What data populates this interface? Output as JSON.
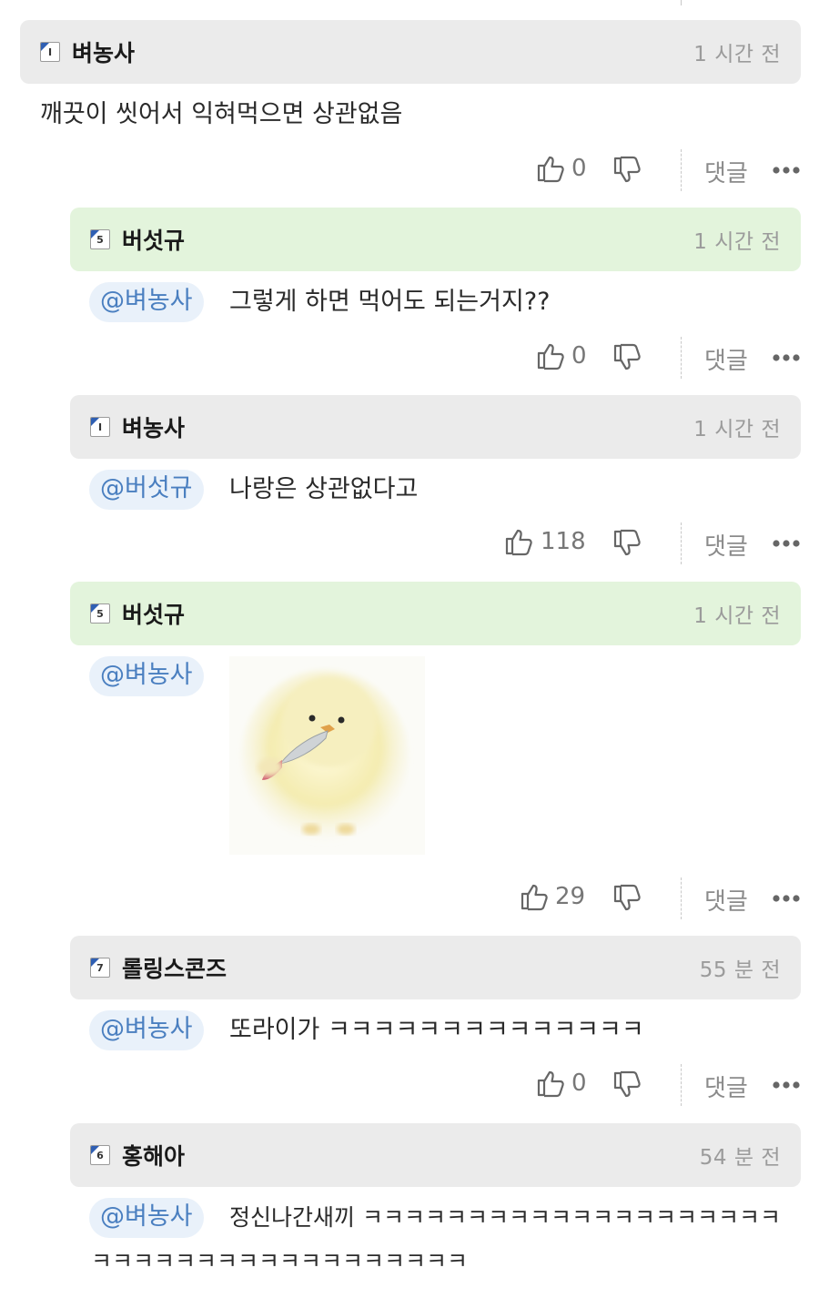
{
  "comments": [
    {
      "nick": "벼농사",
      "level": "I",
      "time": "1 시간 전",
      "mention": "",
      "text": "깨끗이 씻어서 익혀먹으면 상관없음",
      "likes": "0",
      "reply_label": "댓글",
      "op": false
    },
    {
      "nick": "버섯규",
      "level": "5",
      "time": "1 시간 전",
      "mention": "@벼농사",
      "text": "그렇게 하면 먹어도 되는거지??",
      "likes": "0",
      "reply_label": "댓글",
      "op": true
    },
    {
      "nick": "벼농사",
      "level": "I",
      "time": "1 시간 전",
      "mention": "@버섯규",
      "text": "나랑은 상관없다고",
      "likes": "118",
      "reply_label": "댓글",
      "op": false
    },
    {
      "nick": "버섯규",
      "level": "5",
      "time": "1 시간 전",
      "mention": "@벼농사",
      "text": "",
      "likes": "29",
      "reply_label": "댓글",
      "op": true,
      "image": "chick-holding-knife"
    },
    {
      "nick": "롤링스콘즈",
      "level": "7",
      "time": "55 분 전",
      "mention": "@벼농사",
      "text": "또라이가 ㅋㅋㅋㅋㅋㅋㅋㅋㅋㅋㅋㅋㅋㅋ",
      "likes": "0",
      "reply_label": "댓글",
      "op": false
    },
    {
      "nick": "홍해아",
      "level": "6",
      "time": "54 분 전",
      "mention": "@벼농사",
      "text": "정신나간새끼 ㅋㅋㅋㅋㅋㅋㅋㅋㅋㅋㅋㅋㅋㅋㅋㅋㅋㅋㅋㅋ",
      "text2": "ㅋㅋㅋㅋㅋㅋㅋㅋㅋㅋㅋㅋㅋㅋㅋㅋㅋㅋ",
      "op": false
    }
  ],
  "colors": {
    "op_header": "#e3f4dc",
    "header": "#ebebeb",
    "mention_bg": "#e9f1fa",
    "mention_text": "#4a7fc0",
    "level_badge_corner": "#2f5fb3"
  },
  "icons": {
    "like": "thumbs-up-icon",
    "dislike": "thumbs-down-icon",
    "more": "more-dots-icon",
    "level": "level-badge-icon"
  }
}
